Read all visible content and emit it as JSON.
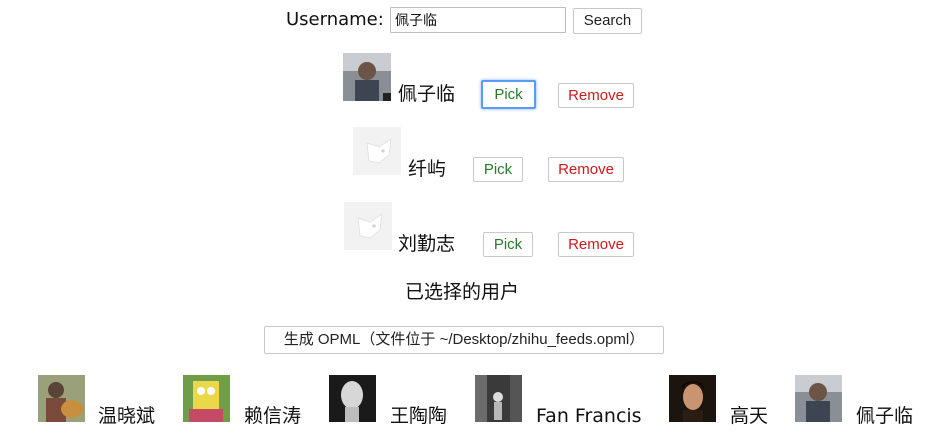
{
  "search": {
    "label": "Username:",
    "value": "佩子临",
    "button": "Search"
  },
  "results": [
    {
      "name": "佩子临",
      "pick": "Pick",
      "remove": "Remove",
      "avatar": "photo"
    },
    {
      "name": "纤屿",
      "pick": "Pick",
      "remove": "Remove",
      "avatar": "default-dog"
    },
    {
      "name": "刘勤志",
      "pick": "Pick",
      "remove": "Remove",
      "avatar": "default-dog"
    }
  ],
  "selected": {
    "heading": "已选择的用户",
    "opml_button": "生成 OPML（文件位于 ~/Desktop/zhihu_feeds.opml）",
    "users": [
      {
        "name": "温晓斌"
      },
      {
        "name": "赖信涛"
      },
      {
        "name": "王陶陶"
      },
      {
        "name": "Fan Francis"
      },
      {
        "name": "高天"
      },
      {
        "name": "佩子临"
      }
    ]
  },
  "colors": {
    "pick": "#2a7a2a",
    "remove": "#cc1b1b",
    "focus": "#5a9bf3"
  }
}
